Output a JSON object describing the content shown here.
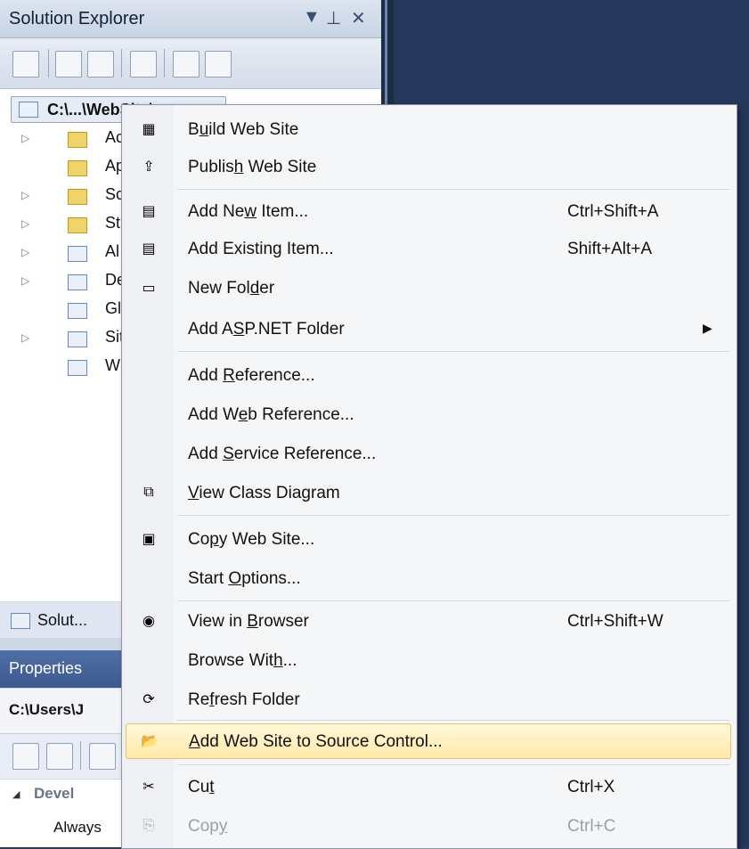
{
  "solution_explorer": {
    "title": "Solution Explorer",
    "header_buttons": [
      "▼",
      "⊥",
      "✕"
    ],
    "root_label": "C:\\...\\WebSite\\",
    "tree_items": [
      "Ac",
      "Ap",
      "Sc",
      "St",
      "Al",
      "De",
      "Gl",
      "Sit",
      "W"
    ],
    "bottom_tab": "Solut..."
  },
  "properties": {
    "title": "Properties",
    "object": "C:\\Users\\J",
    "category": "Devel",
    "row": "Always"
  },
  "menu": {
    "build": {
      "pre": "B",
      "u": "u",
      "post": "ild Web Site"
    },
    "publish": {
      "pre": "Publis",
      "u": "h",
      "post": " Web Site"
    },
    "add_new": {
      "pre": "Add Ne",
      "u": "w",
      "post": " Item...",
      "shortcut": "Ctrl+Shift+A"
    },
    "add_existing": {
      "pre": "Add Existin",
      "u": "g",
      "post": " Item...",
      "shortcut": "Shift+Alt+A"
    },
    "new_folder": {
      "pre": "New Fol",
      "u": "d",
      "post": "er"
    },
    "asp_folder": {
      "pre": "Add A",
      "u": "S",
      "post": "P.NET Folder",
      "arrow": "▶"
    },
    "add_reference": {
      "pre": "Add ",
      "u": "R",
      "post": "eference..."
    },
    "add_web_ref": {
      "pre": "Add W",
      "u": "e",
      "post": "b Reference..."
    },
    "add_service_ref": {
      "pre": "Add ",
      "u": "S",
      "post": "ervice Reference..."
    },
    "class_diagram": {
      "pre": "",
      "u": "V",
      "post": "iew Class Diagram"
    },
    "copy_site": {
      "pre": "Co",
      "u": "p",
      "post": "y Web Site..."
    },
    "start_options": {
      "pre": "Start ",
      "u": "O",
      "post": "ptions..."
    },
    "view_browser": {
      "pre": "View in ",
      "u": "B",
      "post": "rowser",
      "shortcut": "Ctrl+Shift+W"
    },
    "browse_with": {
      "pre": "Browse Wit",
      "u": "h",
      "post": "..."
    },
    "refresh": {
      "pre": "Re",
      "u": "f",
      "post": "resh Folder"
    },
    "source_control": {
      "pre": "",
      "u": "A",
      "post": "dd Web Site to Source Control..."
    },
    "cut": {
      "pre": "Cu",
      "u": "t",
      "post": "",
      "shortcut": "Ctrl+X"
    },
    "copy": {
      "pre": "Cop",
      "u": "y",
      "post": "",
      "shortcut": "Ctrl+C"
    }
  },
  "colors": {
    "highlight": "#ffe9a8",
    "editor_bg": "#25385b",
    "menu_bg": "#f5f6f7"
  }
}
